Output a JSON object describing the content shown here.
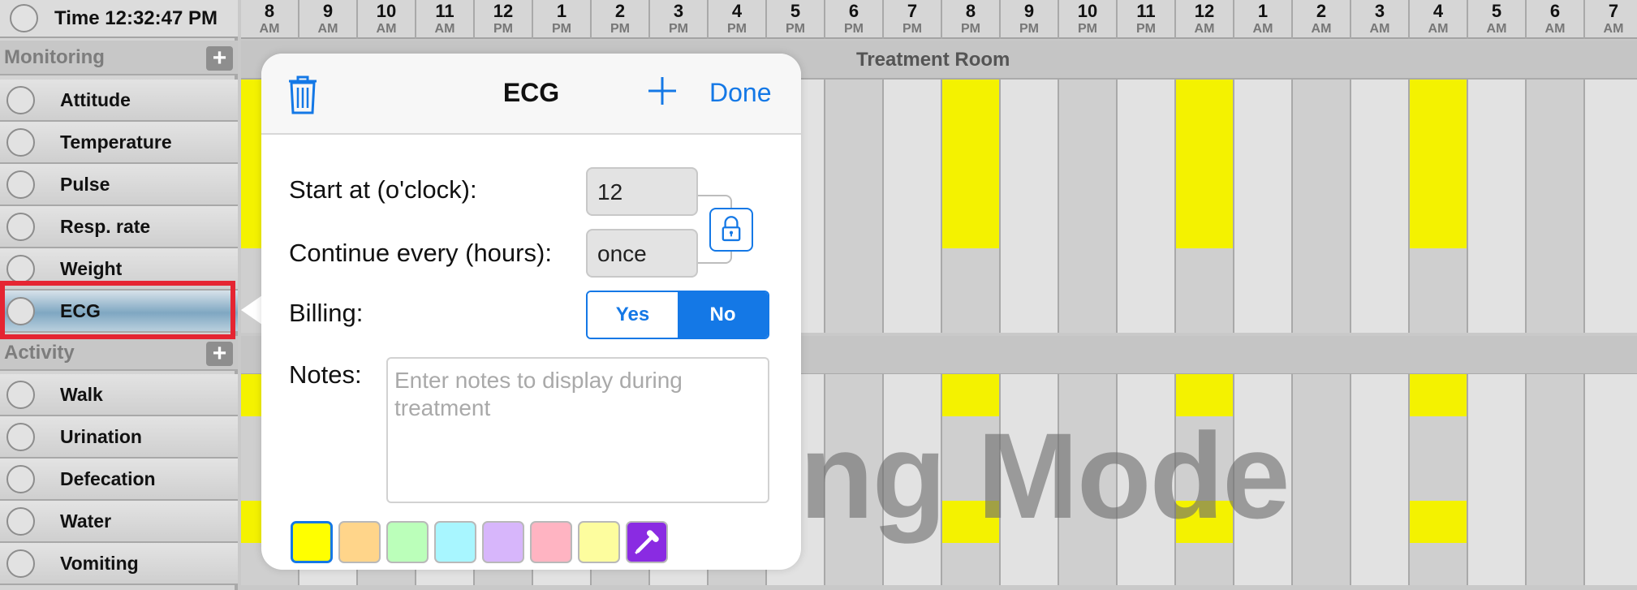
{
  "header": {
    "time_label": "Time 12:32:47 PM"
  },
  "hours": [
    {
      "h": "8",
      "ap": "AM"
    },
    {
      "h": "9",
      "ap": "AM"
    },
    {
      "h": "10",
      "ap": "AM"
    },
    {
      "h": "11",
      "ap": "AM"
    },
    {
      "h": "12",
      "ap": "PM"
    },
    {
      "h": "1",
      "ap": "PM"
    },
    {
      "h": "2",
      "ap": "PM"
    },
    {
      "h": "3",
      "ap": "PM"
    },
    {
      "h": "4",
      "ap": "PM"
    },
    {
      "h": "5",
      "ap": "PM"
    },
    {
      "h": "6",
      "ap": "PM"
    },
    {
      "h": "7",
      "ap": "PM"
    },
    {
      "h": "8",
      "ap": "PM"
    },
    {
      "h": "9",
      "ap": "PM"
    },
    {
      "h": "10",
      "ap": "PM"
    },
    {
      "h": "11",
      "ap": "PM"
    },
    {
      "h": "12",
      "ap": "AM"
    },
    {
      "h": "1",
      "ap": "AM"
    },
    {
      "h": "2",
      "ap": "AM"
    },
    {
      "h": "3",
      "ap": "AM"
    },
    {
      "h": "4",
      "ap": "AM"
    },
    {
      "h": "5",
      "ap": "AM"
    },
    {
      "h": "6",
      "ap": "AM"
    },
    {
      "h": "7",
      "ap": "AM"
    }
  ],
  "sections": [
    {
      "title": "Monitoring",
      "add_label": "+",
      "band_title": "Treatment Room",
      "rows": [
        {
          "label": "Attitude"
        },
        {
          "label": "Temperature"
        },
        {
          "label": "Pulse"
        },
        {
          "label": "Resp. rate"
        },
        {
          "label": "Weight"
        },
        {
          "label": "ECG",
          "selected": true
        }
      ]
    },
    {
      "title": "Activity",
      "add_label": "+",
      "band_title": "",
      "rows": [
        {
          "label": "Walk"
        },
        {
          "label": "Urination"
        },
        {
          "label": "Defecation"
        },
        {
          "label": "Water"
        },
        {
          "label": "Vomiting"
        }
      ]
    }
  ],
  "scheduled_hours": {
    "Attitude": [
      0,
      12,
      16,
      20
    ],
    "Temperature": [
      0,
      12,
      16,
      20
    ],
    "Pulse": [
      0,
      12,
      16,
      20
    ],
    "Resp. rate": [
      0,
      12,
      16,
      20
    ],
    "Walk": [
      0,
      12,
      16,
      20
    ],
    "Water": [
      0,
      12,
      16,
      20
    ]
  },
  "watermark": "ng Mode",
  "popover": {
    "title": "ECG",
    "done_label": "Done",
    "start_label": "Start at (o'clock):",
    "start_value": "12",
    "continue_label": "Continue every (hours):",
    "continue_value": "once",
    "billing_label": "Billing:",
    "billing_yes": "Yes",
    "billing_no": "No",
    "billing_selected": "No",
    "notes_label": "Notes:",
    "notes_placeholder": "Enter notes to display during treatment",
    "swatches": [
      "#ffff00",
      "#ffd58a",
      "#bbffba",
      "#a8f6ff",
      "#d7b6fb",
      "#ffb4c2",
      "#fdfd9e"
    ],
    "selected_swatch": 0
  },
  "colors": {
    "accent": "#1478e6",
    "scheduled": "#f4f200",
    "selection": "#e52532"
  }
}
